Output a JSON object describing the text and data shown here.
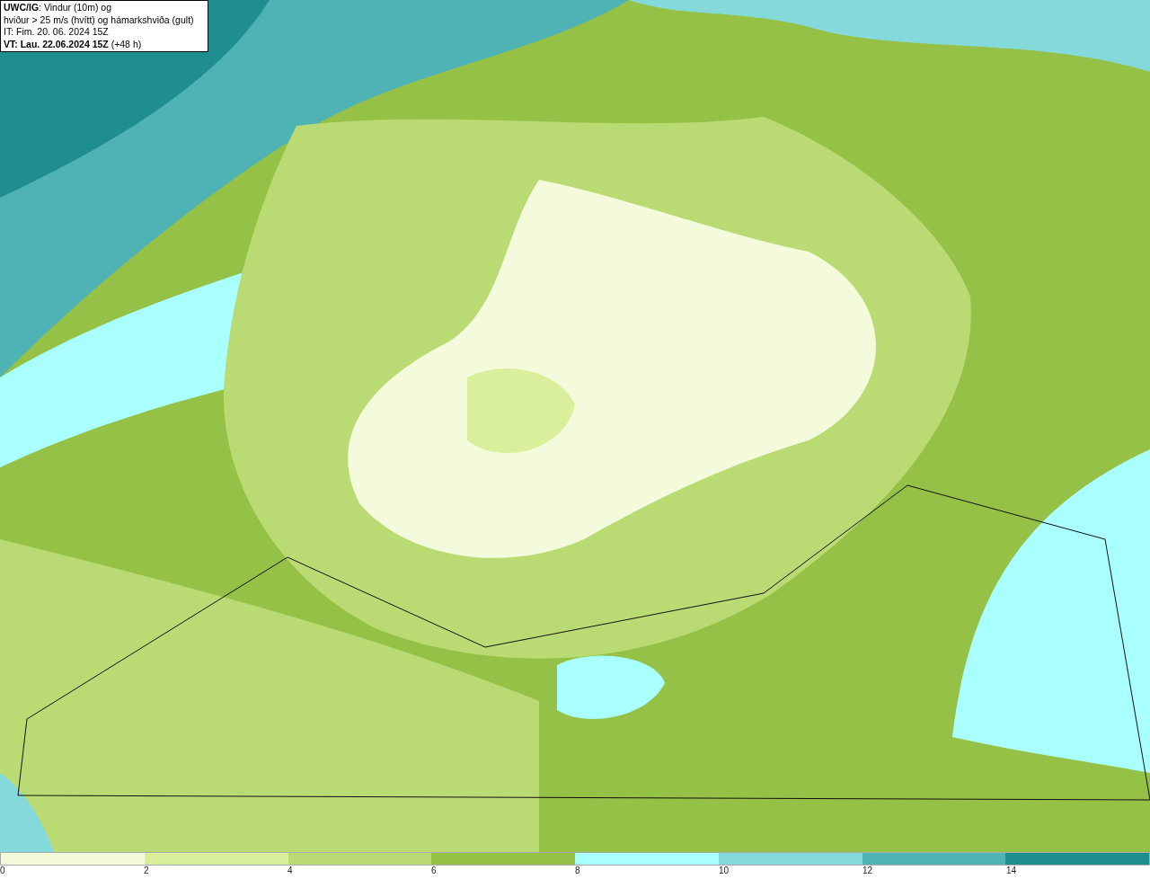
{
  "title_box": {
    "lines": [
      "**UWC/IG**: Vindur (10m) og",
      "hviður > 25 m/s (hvítt) og hámarkshviða (gult)",
      "IT: Fim. 20. 06. 2024 15Z",
      "**VT: Lau. 22.06.2024 15Z** (+48 h)"
    ]
  },
  "colorbar": {
    "segments": [
      {
        "color": "#f4fbdc"
      },
      {
        "color": "#d9ef9c"
      },
      {
        "color": "#badb74"
      },
      {
        "color": "#95c147"
      },
      {
        "color": "#aaffff"
      },
      {
        "color": "#84d9db"
      },
      {
        "color": "#4fb2b4"
      },
      {
        "color": "#208e8e"
      }
    ],
    "ticks": [
      "0",
      "2",
      "4",
      "6",
      "8",
      "10",
      "12",
      "14"
    ]
  }
}
